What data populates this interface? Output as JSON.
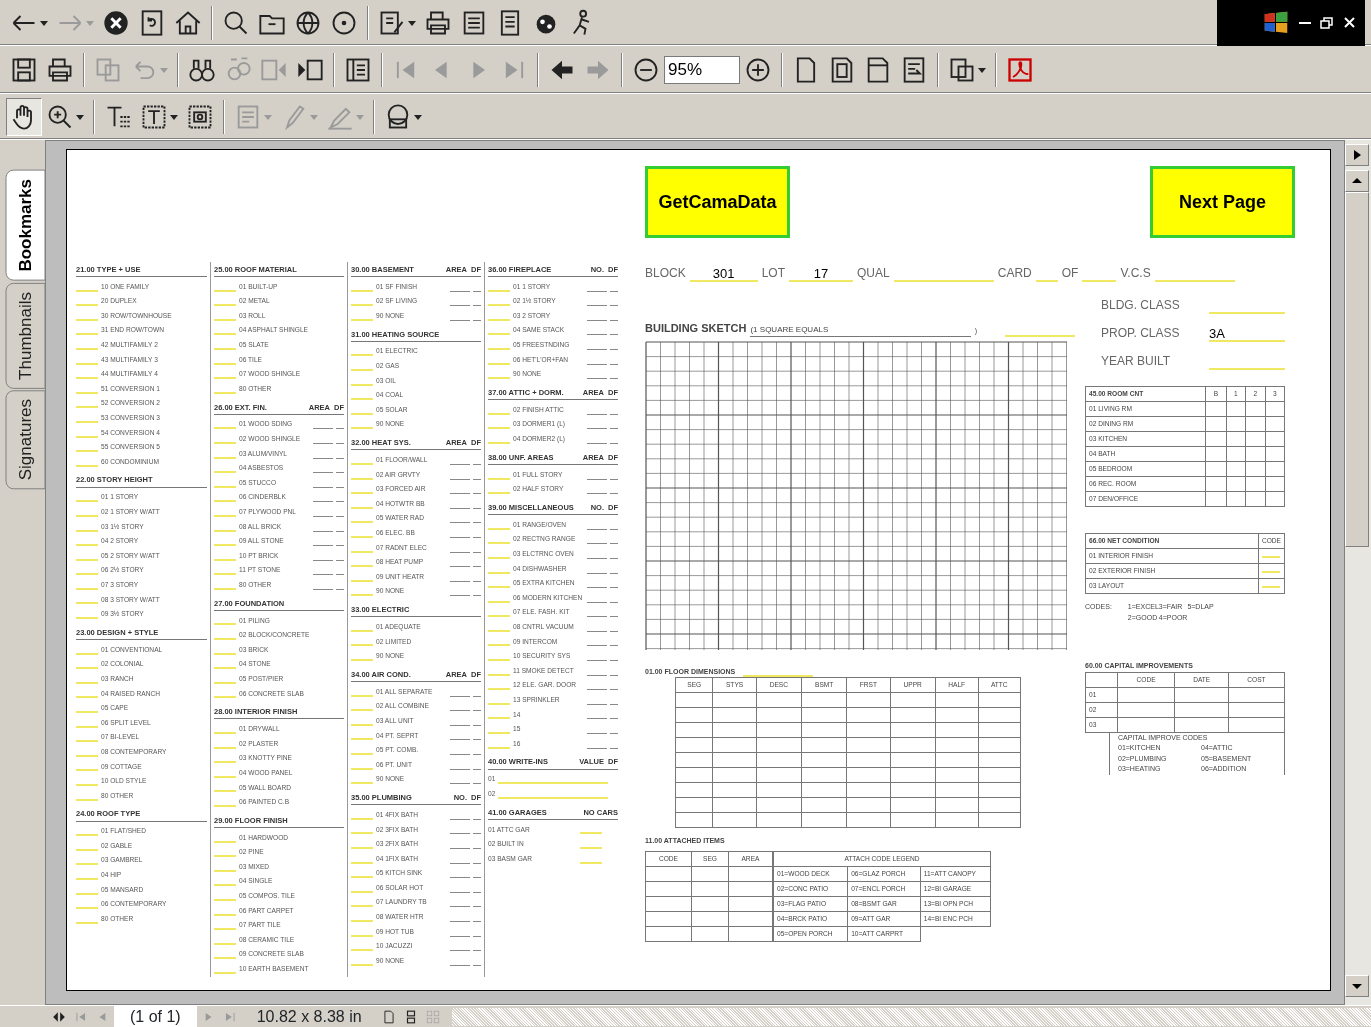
{
  "toolbars": [
    [
      {
        "kind": "back",
        "disabled": false,
        "menu": true
      },
      {
        "kind": "forward",
        "disabled": true,
        "menu": true
      },
      {
        "kind": "stop",
        "disabled": false,
        "menu": false
      },
      {
        "kind": "refresh",
        "disabled": false,
        "menu": false
      },
      {
        "kind": "home",
        "disabled": false,
        "menu": false
      },
      {
        "kind": "sep"
      },
      {
        "kind": "search",
        "disabled": false,
        "menu": false
      },
      {
        "kind": "folder",
        "disabled": false,
        "menu": false
      },
      {
        "kind": "globe",
        "disabled": false,
        "menu": false
      },
      {
        "kind": "disc",
        "disabled": false,
        "menu": false
      },
      {
        "kind": "sep"
      },
      {
        "kind": "edit",
        "disabled": false,
        "menu": true
      },
      {
        "kind": "print",
        "disabled": false,
        "menu": false
      },
      {
        "kind": "notepad",
        "disabled": false,
        "menu": false
      },
      {
        "kind": "doc",
        "disabled": false,
        "menu": false
      },
      {
        "kind": "bug",
        "disabled": false,
        "menu": false
      },
      {
        "kind": "person",
        "disabled": false,
        "menu": false
      }
    ],
    [
      {
        "kind": "save",
        "disabled": false,
        "menu": false
      },
      {
        "kind": "print",
        "disabled": false,
        "menu": false
      },
      {
        "kind": "sep"
      },
      {
        "kind": "copy",
        "disabled": true,
        "menu": false
      },
      {
        "kind": "undo",
        "disabled": true,
        "menu": true
      },
      {
        "kind": "sep"
      },
      {
        "kind": "binoculars",
        "disabled": false,
        "menu": false
      },
      {
        "kind": "findpages",
        "disabled": true,
        "menu": false
      },
      {
        "kind": "prevdoc",
        "disabled": true,
        "menu": false
      },
      {
        "kind": "nextdoc",
        "disabled": false,
        "menu": false
      },
      {
        "kind": "sep"
      },
      {
        "kind": "panel",
        "disabled": false,
        "menu": false
      },
      {
        "kind": "sep"
      },
      {
        "kind": "first",
        "disabled": true,
        "menu": false
      },
      {
        "kind": "prev",
        "disabled": true,
        "menu": false
      },
      {
        "kind": "next",
        "disabled": true,
        "menu": false
      },
      {
        "kind": "last",
        "disabled": true,
        "menu": false
      },
      {
        "kind": "sep"
      },
      {
        "kind": "goback",
        "disabled": false,
        "menu": false
      },
      {
        "kind": "goforward",
        "disabled": true,
        "menu": false
      },
      {
        "kind": "sep"
      },
      {
        "kind": "zoomout",
        "disabled": false,
        "menu": false
      },
      {
        "kind": "zoomfield"
      },
      {
        "kind": "zoomin",
        "disabled": false,
        "menu": false
      },
      {
        "kind": "sep"
      },
      {
        "kind": "page",
        "disabled": false,
        "menu": false
      },
      {
        "kind": "fitpage",
        "disabled": false,
        "menu": false
      },
      {
        "kind": "fitwidth",
        "disabled": false,
        "menu": false
      },
      {
        "kind": "reflow",
        "disabled": false,
        "menu": false
      },
      {
        "kind": "sep"
      },
      {
        "kind": "rotate",
        "disabled": false,
        "menu": true
      },
      {
        "kind": "sep"
      },
      {
        "kind": "pdf",
        "disabled": false,
        "menu": false
      }
    ],
    [
      {
        "kind": "hand",
        "disabled": false,
        "menu": false,
        "selected": true
      },
      {
        "kind": "zoomtool",
        "disabled": false,
        "menu": true,
        "selected": false
      },
      {
        "kind": "sep"
      },
      {
        "kind": "textselect",
        "disabled": false,
        "menu": false,
        "selected": false
      },
      {
        "kind": "colselect",
        "disabled": false,
        "menu": true,
        "selected": false
      },
      {
        "kind": "snapshot",
        "disabled": false,
        "menu": false,
        "selected": false
      },
      {
        "kind": "sep"
      },
      {
        "kind": "note",
        "disabled": true,
        "menu": true,
        "selected": false
      },
      {
        "kind": "pencil",
        "disabled": true,
        "menu": true,
        "selected": false
      },
      {
        "kind": "highlighter",
        "disabled": true,
        "menu": true,
        "selected": false
      },
      {
        "kind": "sep"
      },
      {
        "kind": "stamp",
        "disabled": false,
        "menu": true,
        "selected": false
      }
    ]
  ],
  "zoom_field": {
    "value": "95%"
  },
  "side_tabs": [
    {
      "label": "Bookmarks",
      "selected": true
    },
    {
      "label": "Thumbnails",
      "selected": false
    },
    {
      "label": "Signatures",
      "selected": false
    }
  ],
  "document": {
    "buttons": [
      "GetCamaData",
      "Next Page"
    ],
    "header_fields": [
      {
        "label": "BLOCK",
        "value": "301"
      },
      {
        "label": "LOT",
        "value": "17"
      },
      {
        "label": "QUAL"
      },
      {
        "label": "CARD"
      },
      {
        "label": "OF"
      },
      {
        "label": "V.C.S"
      }
    ],
    "class_fields": [
      {
        "label": "BLDG. CLASS"
      },
      {
        "label": "PROP. CLASS",
        "value": "3A"
      },
      {
        "label": "YEAR BUILT"
      }
    ],
    "form_columns": [
      [
        {
          "title": "21.00 TYPE + USE",
          "items": [
            "10 ONE FAMILY",
            "20 DUPLEX",
            "30 ROW/TOWNHOUSE",
            "31 END ROW/TOWN",
            "42 MULTIFAMILY 2",
            "43 MULTIFAMILY 3",
            "44 MULTIFAMILY 4",
            "51 CONVERSION 1",
            "52 CONVERSION 2",
            "53 CONVERSION 3",
            "54 CONVERSION 4",
            "55 CONVERSION 5",
            "60 CONDOMINIUM"
          ]
        },
        {
          "title": "22.00 STORY HEIGHT",
          "items": [
            "01 1 STORY",
            "02 1 STORY W/ATT",
            "03 1½ STORY",
            "04 2 STORY",
            "05 2 STORY W/ATT",
            "06 2½ STORY",
            "07 3 STORY",
            "08 3 STORY W/ATT",
            "09 3½ STORY"
          ]
        },
        {
          "title": "23.00 DESIGN + STYLE",
          "items": [
            "01 CONVENTIONAL",
            "02 COLONIAL",
            "03 RANCH",
            "04 RAISED RANCH",
            "05 CAPE",
            "06 SPLIT LEVEL",
            "07 BI-LEVEL",
            "08 CONTEMPORARY",
            "09 COTTAGE",
            "10 OLD STYLE",
            "80 OTHER"
          ]
        },
        {
          "title": "24.00 ROOF TYPE",
          "items": [
            "01 FLAT/SHED",
            "02 GABLE",
            "03 GAMBREL",
            "04 HIP",
            "05 MANSARD",
            "06 CONTEMPORARY",
            "80 OTHER"
          ]
        }
      ],
      [
        {
          "title": "25.00 ROOF MATERIAL",
          "items": [
            "01 BUILT-UP",
            "02 METAL",
            "03 ROLL",
            "04 ASPHALT SHINGLE",
            "05 SLATE",
            "06 TILE",
            "07 WOOD SHINGLE",
            "80 OTHER"
          ]
        },
        {
          "title": "26.00 EXT. FIN.",
          "cols": [
            "AREA",
            "DF"
          ],
          "items": [
            "01 WOOD SDING",
            "02 WOOD SHINGLE",
            "03 ALUM/VINYL",
            "04 ASBESTOS",
            "05 STUCCO",
            "06 CINDERBLK",
            "07 PLYWOOD PNL",
            "08 ALL BRICK",
            "09 ALL STONE",
            "10 PT BRICK",
            "11 PT STONE",
            "80 OTHER"
          ]
        },
        {
          "title": "27.00 FOUNDATION",
          "items": [
            "01 PILING",
            "02 BLOCK/CONCRETE",
            "03 BRICK",
            "04 STONE",
            "05 POST/PIER",
            "06 CONCRETE SLAB"
          ]
        },
        {
          "title": "28.00 INTERIOR FINISH",
          "items": [
            "01 DRYWALL",
            "02 PLASTER",
            "03 KNOTTY PINE",
            "04 WOOD PANEL",
            "05 WALL BOARD",
            "06 PAINTED C.B"
          ]
        },
        {
          "title": "29.00 FLOOR FINISH",
          "items": [
            "01 HARDWOOD",
            "02 PINE",
            "03 MIXED",
            "04 SINGLE",
            "05 COMPOS. TILE",
            "06 PART CARPET",
            "07 PART TILE",
            "08 CERAMIC TILE",
            "09 CONCRETE SLAB",
            "10 EARTH BASEMENT"
          ]
        }
      ],
      [
        {
          "title": "30.00 BASEMENT",
          "cols": [
            "AREA",
            "DF"
          ],
          "items": [
            "01 SF FINISH",
            "02 SF LIVING",
            "90 NONE"
          ]
        },
        {
          "title": "31.00 HEATING SOURCE",
          "items": [
            "01 ELECTRIC",
            "02 GAS",
            "03 OIL",
            "04 COAL",
            "05 SOLAR",
            "90 NONE"
          ]
        },
        {
          "title": "32.00 HEAT SYS.",
          "cols": [
            "AREA",
            "DF"
          ],
          "items": [
            "01 FLOOR/WALL",
            "02 AIR GRVTY",
            "03 FORCED AIR",
            "04 HOTWTR BB",
            "05 WATER RAD",
            "06 ELEC. BB",
            "07 RADNT ELEC",
            "08 HEAT PUMP",
            "09 UNIT HEATR",
            "90 NONE"
          ]
        },
        {
          "title": "33.00 ELECTRIC",
          "items": [
            "01 ADEQUATE",
            "02 LIMITED",
            "90 NONE"
          ]
        },
        {
          "title": "34.00 AIR COND.",
          "cols": [
            "AREA",
            "DF"
          ],
          "items": [
            "01 ALL SEPARATE",
            "02 ALL COMBINE",
            "03 ALL UNIT",
            "04 PT. SEPRT",
            "05 PT. COMB.",
            "06 PT. UNIT",
            "90 NONE"
          ]
        },
        {
          "title": "35.00 PLUMBING",
          "cols": [
            "NO.",
            "DF"
          ],
          "items": [
            "01 4FIX BATH",
            "02 3FIX BATH",
            "03 2FIX BATH",
            "04 1FIX BATH",
            "05 KITCH SINK",
            "06 SOLAR HOT",
            "07 LAUNDRY TB",
            "08 WATER HTR",
            "09 HOT TUB",
            "10 JACUZZI",
            "90 NONE"
          ]
        }
      ],
      [
        {
          "title": "36.00 FIREPLACE",
          "cols": [
            "NO.",
            "DF"
          ],
          "items": [
            "01 1 STORY",
            "02 1½ STORY",
            "03 2 STORY",
            "04 SAME STACK",
            "05 FREESTNDING",
            "06 HET'L'OR+FAN",
            "90 NONE"
          ]
        },
        {
          "title": "37.00 ATTIC + DORM.",
          "cols": [
            "AREA",
            "DF"
          ],
          "items": [
            "02 FINISH ATTIC",
            "03 DORMER1 (L)",
            "04 DORMER2 (L)"
          ]
        },
        {
          "title": "38.00 UNF. AREAS",
          "cols": [
            "AREA",
            "DF"
          ],
          "items": [
            "01 FULL STORY",
            "02 HALF STORY"
          ]
        },
        {
          "title": "39.00 MISCELLANEOUS",
          "cols": [
            "NO.",
            "DF"
          ],
          "items": [
            "01 RANGE/OVEN",
            "02 RECTNG RANGE",
            "03 ELCTRNC OVEN",
            "04 DISHWASHER",
            "05 EXTRA KITCHEN",
            "06 MODERN KITCHEN",
            "07 ELE. FASH. KIT",
            "08 CNTRL VACUUM",
            "09 INTERCOM",
            "10 SECURITY SYS",
            "11 SMOKE DETECT",
            "12 ELE. GAR. DOOR",
            "13 SPRINKLER",
            "14",
            "15",
            "16"
          ]
        },
        {
          "title": "40.00 WRITE-INS",
          "cols": [
            "VALUE",
            "DF"
          ],
          "kind": "writein",
          "items": [
            "01",
            "02"
          ]
        },
        {
          "title": "41.00 GARAGES",
          "cols": [
            "NO CARS"
          ],
          "kind": "garage",
          "items": [
            "01 ATTC GAR",
            "02 BUILT IN",
            "03 BASM GAR"
          ]
        }
      ]
    ],
    "sketch": {
      "title": "BUILDING SKETCH",
      "note": "(1 SQUARE EQUALS",
      "note_end": ")"
    },
    "room_count": {
      "title": "45.00 ROOM CNT",
      "columns": [
        "B",
        "1",
        "2",
        "3"
      ],
      "rows": [
        "01 LIVING RM",
        "02 DINING RM",
        "03 KITCHEN",
        "04 BATH",
        "05 BEDROOM",
        "06 REC. ROOM",
        "07 DEN/OFFICE"
      ]
    },
    "net_condition": {
      "title": "66.00 NET CONDITION",
      "code_label": "CODE",
      "rows": [
        "01 INTERIOR FINISH",
        "02 EXTERIOR FINISH",
        "03 LAYOUT"
      ]
    },
    "codes": {
      "label": "CODES:",
      "entries": [
        "1=EXCEL",
        "3=FAIR",
        "5=DLAP",
        "2=GOOD",
        "4=POOR"
      ]
    },
    "floor_dimensions": {
      "title": "01.00 FLOOR DIMENSIONS",
      "columns": [
        "SEG",
        "STYS",
        "DESC",
        "BSMT",
        "FRST",
        "UPPR",
        "HALF",
        "ATTC"
      ]
    },
    "capital_improvements": {
      "title": "60.00 CAPITAL IMPROVEMENTS",
      "columns": [
        "CODE",
        "DATE",
        "COST"
      ],
      "rows": [
        "01",
        "02",
        "03"
      ],
      "codes_title": "CAPITAL IMPROVE CODES",
      "codes": [
        "01=KITCHEN",
        "04=ATTIC",
        "02=PLUMBING",
        "05=BASEMENT",
        "03=HEATING",
        "06=ADDITION"
      ]
    },
    "attached_items": {
      "title": "11.00 ATTACHED ITEMS",
      "columns": [
        "CODE",
        "SEG",
        "AREA"
      ],
      "legend_title": "ATTACH CODE LEGEND",
      "legend": [
        [
          "01=WOOD DECK",
          "06=GLAZ PORCH",
          "11=ATT CANOPY"
        ],
        [
          "02=CONC PATIO",
          "07=ENCL PORCH",
          "12=BI GARAGE"
        ],
        [
          "03=FLAG PATIO",
          "08=BSMT GAR",
          "13=BI OPN PCH"
        ],
        [
          "04=BRCK PATIO",
          "09=ATT GAR",
          "14=BI ENC PCH"
        ],
        [
          "05=OPEN PORCH",
          "10=ATT CARPRT"
        ]
      ]
    }
  },
  "status_bar": {
    "page": "(1 of 1)",
    "size": "10.82 x 8.38 in"
  }
}
